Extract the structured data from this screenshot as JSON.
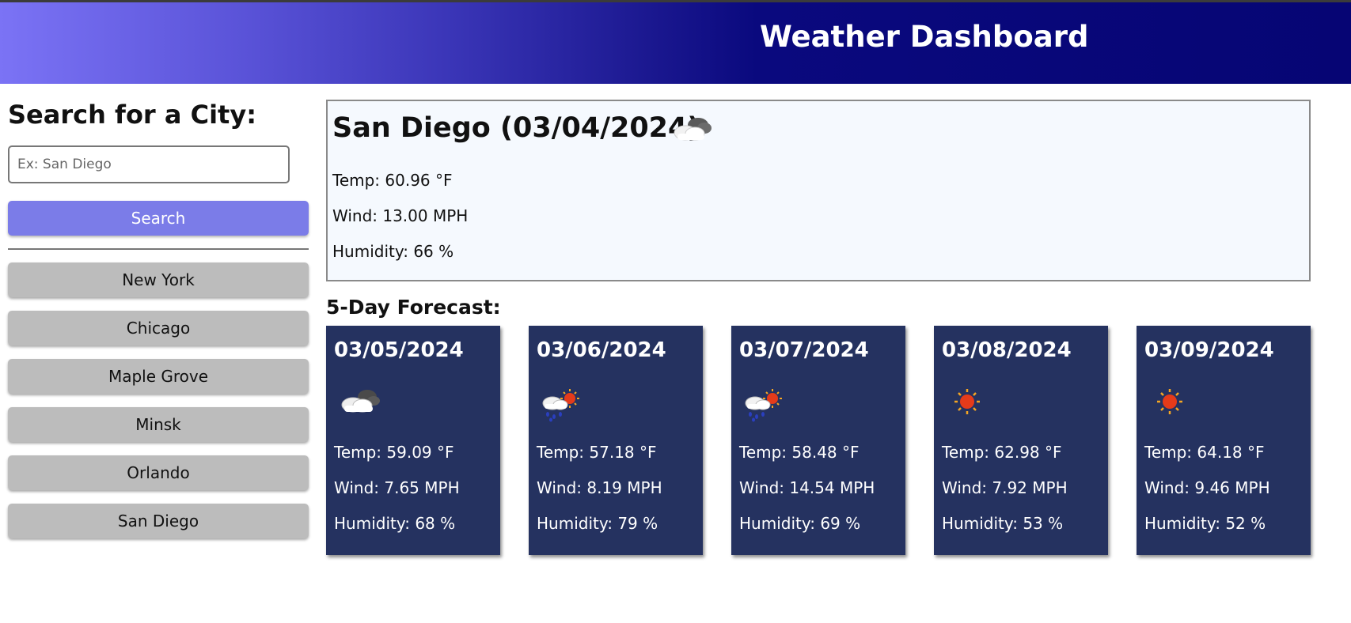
{
  "header": {
    "title": "Weather Dashboard"
  },
  "sidebar": {
    "heading": "Search for a City:",
    "search_placeholder": "Ex: San Diego",
    "search_label": "Search",
    "history": [
      "New York",
      "Chicago",
      "Maple Grove",
      "Minsk",
      "Orlando",
      "San Diego"
    ]
  },
  "current": {
    "title": "San Diego (03/04/2024)",
    "icon": "cloud-icon",
    "temp": "Temp: 60.96 °F",
    "wind": "Wind: 13.00 MPH",
    "humidity": "Humidity: 66 %"
  },
  "forecast": {
    "title": "5-Day Forecast:",
    "days": [
      {
        "date": "03/05/2024",
        "icon": "cloud-icon",
        "temp": "Temp: 59.09 °F",
        "wind": "Wind: 7.65 MPH",
        "humidity": "Humidity: 68 %"
      },
      {
        "date": "03/06/2024",
        "icon": "rain-sun-icon",
        "temp": "Temp: 57.18 °F",
        "wind": "Wind: 8.19 MPH",
        "humidity": "Humidity: 79 %"
      },
      {
        "date": "03/07/2024",
        "icon": "rain-sun-icon",
        "temp": "Temp: 58.48 °F",
        "wind": "Wind: 14.54 MPH",
        "humidity": "Humidity: 69 %"
      },
      {
        "date": "03/08/2024",
        "icon": "sun-icon",
        "temp": "Temp: 62.98 °F",
        "wind": "Wind: 7.92 MPH",
        "humidity": "Humidity: 53 %"
      },
      {
        "date": "03/09/2024",
        "icon": "sun-icon",
        "temp": "Temp: 64.18 °F",
        "wind": "Wind: 9.46 MPH",
        "humidity": "Humidity: 52 %"
      }
    ]
  },
  "colors": {
    "header_start": "#7b73f5",
    "header_end": "#060574",
    "search_button": "#7b7ce8",
    "history_button": "#bcbcbc",
    "card_background": "#253260",
    "current_background": "#f5f9fe"
  }
}
